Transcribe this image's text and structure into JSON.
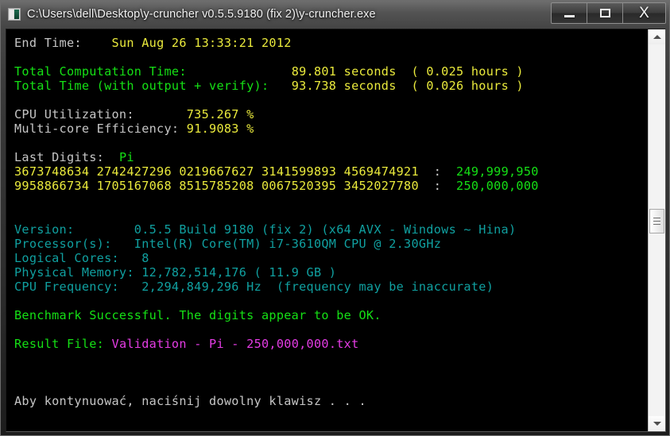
{
  "window": {
    "title": "C:\\Users\\dell\\Desktop\\y-cruncher v0.5.5.9180 (fix 2)\\y-cruncher.exe",
    "icon": "console-window-icon",
    "buttons": {
      "minimize": "minimize-button",
      "maximize": "maximize-button",
      "close": "X"
    },
    "colors": {
      "console_background": "#000000",
      "white": "#c6c6c6",
      "yellow": "#eaea3c",
      "green": "#15e015",
      "teal": "#10a0a0",
      "magenta": "#e43ce4"
    }
  },
  "console": {
    "end_time": {
      "label": "End Time:",
      "value": "Sun Aug 26 13:33:21 2012"
    },
    "timing": {
      "computation_label": "Total Computation Time:",
      "computation_seconds": "89.801 seconds",
      "computation_hours": "( 0.025 hours )",
      "total_label": "Total Time (with output + verify):",
      "total_seconds": "93.738 seconds",
      "total_hours": "( 0.026 hours )"
    },
    "utilization": {
      "cpu_label": "CPU Utilization:",
      "cpu_value": "735.267 %",
      "efficiency_label": "Multi-core Efficiency:",
      "efficiency_value": "91.9083 %"
    },
    "last_digits": {
      "label": "Last Digits:",
      "constant": "Pi",
      "rows": [
        {
          "digits": "3673748634 2742427296 0219667627 3141599893 4569474921",
          "separator": ":",
          "position": "249,999,950"
        },
        {
          "digits": "9958866734 1705167068 8515785208 0067520395 3452027780",
          "separator": ":",
          "position": "250,000,000"
        }
      ]
    },
    "system": {
      "version_label": "Version:",
      "version_value": "0.5.5 Build 9180 (fix 2) (x64 AVX - Windows ~ Hina)",
      "processor_label": "Processor(s):",
      "processor_value": "Intel(R) Core(TM) i7-3610QM CPU @ 2.30GHz",
      "cores_label": "Logical Cores:",
      "cores_value": "8",
      "memory_label": "Physical Memory:",
      "memory_value": "12,782,514,176 ( 11.9 GB )",
      "frequency_label": "CPU Frequency:",
      "frequency_value": "2,294,849,296 Hz  (frequency may be inaccurate)"
    },
    "result": {
      "benchmark_status": "Benchmark Successful. The digits appear to be OK.",
      "file_label": "Result File:",
      "file_name": "Validation - Pi - 250,000,000.txt"
    },
    "prompt": "Aby kontynuować, naciśnij dowolny klawisz . . ."
  },
  "scrollbar": {
    "up_arrow": "scroll-up-arrow",
    "down_arrow": "scroll-down-arrow",
    "thumb": "scroll-thumb"
  }
}
